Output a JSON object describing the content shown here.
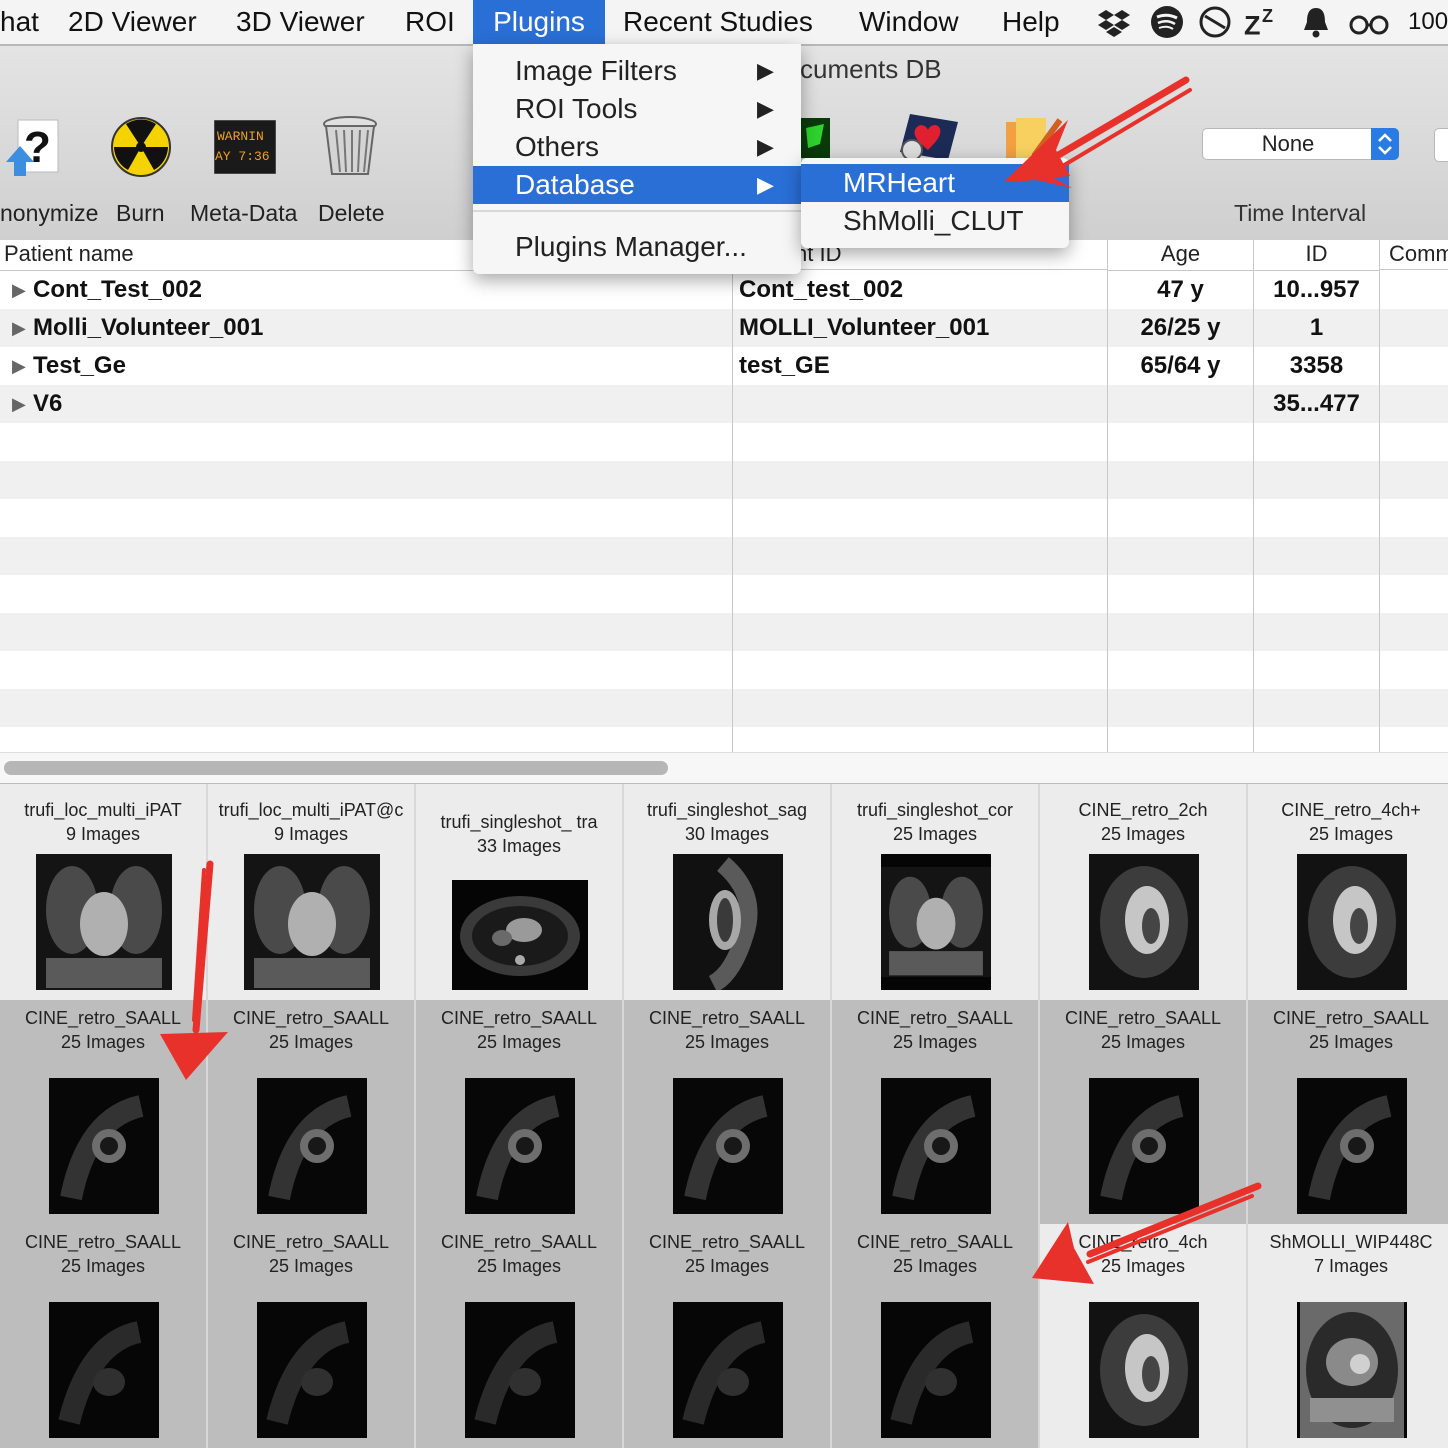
{
  "menubar": {
    "items": [
      "hat",
      "2D Viewer",
      "3D Viewer",
      "ROI",
      "Plugins",
      "Recent Studies",
      "Window",
      "Help"
    ],
    "active": "Plugins",
    "status_text": "100"
  },
  "toolbar": {
    "buttons": [
      "nonymize",
      "Burn",
      "Meta-Data",
      "Delete"
    ],
    "meta_icon_text": "WARNIN\nAY 7:36",
    "db_label": "cuments DB",
    "time_select_value": "None",
    "time_interval_label": "Time Interval"
  },
  "plugins_menu": {
    "items": [
      {
        "label": "Image Filters",
        "submenu": true
      },
      {
        "label": "ROI Tools",
        "submenu": true
      },
      {
        "label": "Others",
        "submenu": true
      },
      {
        "label": "Database",
        "submenu": true,
        "selected": true
      },
      {
        "label": "Plugins Manager...",
        "submenu": false
      }
    ],
    "database_submenu": {
      "items": [
        "MRHeart",
        "ShMolli_CLUT"
      ],
      "selected": "MRHeart"
    }
  },
  "table": {
    "headers": {
      "name": "Patient name",
      "pid": "nt ID",
      "age": "Age",
      "id": "ID",
      "comments": "Comm"
    },
    "rows": [
      {
        "name": "Cont_Test_002",
        "pid": "Cont_test_002",
        "age": "47 y",
        "id": "10...957"
      },
      {
        "name": "Molli_Volunteer_001",
        "pid": "MOLLI_Volunteer_001",
        "age": "26/25 y",
        "id": "1"
      },
      {
        "name": "Test_Ge",
        "pid": "test_GE",
        "age": "65/64 y",
        "id": "3358"
      },
      {
        "name": "V6",
        "pid": "",
        "age": "",
        "id": "35...477"
      }
    ]
  },
  "series": [
    {
      "name": "trufi_loc_multi_iPAT",
      "count": "9 Images",
      "tone": "light",
      "img": "coronal"
    },
    {
      "name": "trufi_loc_multi_iPAT@c",
      "count": "9 Images",
      "tone": "light",
      "img": "coronal"
    },
    {
      "name": "trufi_singleshot_ tra",
      "count": "33 Images",
      "tone": "light",
      "img": "axial"
    },
    {
      "name": "trufi_singleshot_sag",
      "count": "30 Images",
      "tone": "light",
      "img": "sag"
    },
    {
      "name": "trufi_singleshot_cor",
      "count": "25 Images",
      "tone": "light",
      "img": "coronal"
    },
    {
      "name": "CINE_retro_2ch",
      "count": "25 Images",
      "tone": "light",
      "img": "cine"
    },
    {
      "name": "CINE_retro_4ch+",
      "count": "25 Images",
      "tone": "light",
      "img": "cine"
    },
    {
      "name": "CINE_retro_SAALL",
      "count": "25 Images",
      "tone": "dark",
      "img": "sax"
    },
    {
      "name": "CINE_retro_SAALL",
      "count": "25 Images",
      "tone": "dark",
      "img": "sax"
    },
    {
      "name": "CINE_retro_SAALL",
      "count": "25 Images",
      "tone": "dark",
      "img": "sax"
    },
    {
      "name": "CINE_retro_SAALL",
      "count": "25 Images",
      "tone": "dark",
      "img": "sax"
    },
    {
      "name": "CINE_retro_SAALL",
      "count": "25 Images",
      "tone": "dark",
      "img": "sax"
    },
    {
      "name": "CINE_retro_SAALL",
      "count": "25 Images",
      "tone": "dark",
      "img": "sax"
    },
    {
      "name": "CINE_retro_SAALL",
      "count": "25 Images",
      "tone": "dark",
      "img": "sax"
    },
    {
      "name": "CINE_retro_SAALL",
      "count": "25 Images",
      "tone": "dark",
      "img": "saxdim"
    },
    {
      "name": "CINE_retro_SAALL",
      "count": "25 Images",
      "tone": "dark",
      "img": "saxdim"
    },
    {
      "name": "CINE_retro_SAALL",
      "count": "25 Images",
      "tone": "dark",
      "img": "saxdim"
    },
    {
      "name": "CINE_retro_SAALL",
      "count": "25 Images",
      "tone": "dark",
      "img": "saxdim"
    },
    {
      "name": "CINE_retro_SAALL",
      "count": "25 Images",
      "tone": "dark",
      "img": "saxdim"
    },
    {
      "name": "CINE_retro_4ch",
      "count": "25 Images",
      "tone": "light",
      "img": "cine"
    },
    {
      "name": "ShMOLLI_WIP448C",
      "count": "7 Images",
      "tone": "light",
      "img": "molli"
    }
  ],
  "colors": {
    "accent": "#2a6fd6",
    "annotation": "#e8312b"
  }
}
